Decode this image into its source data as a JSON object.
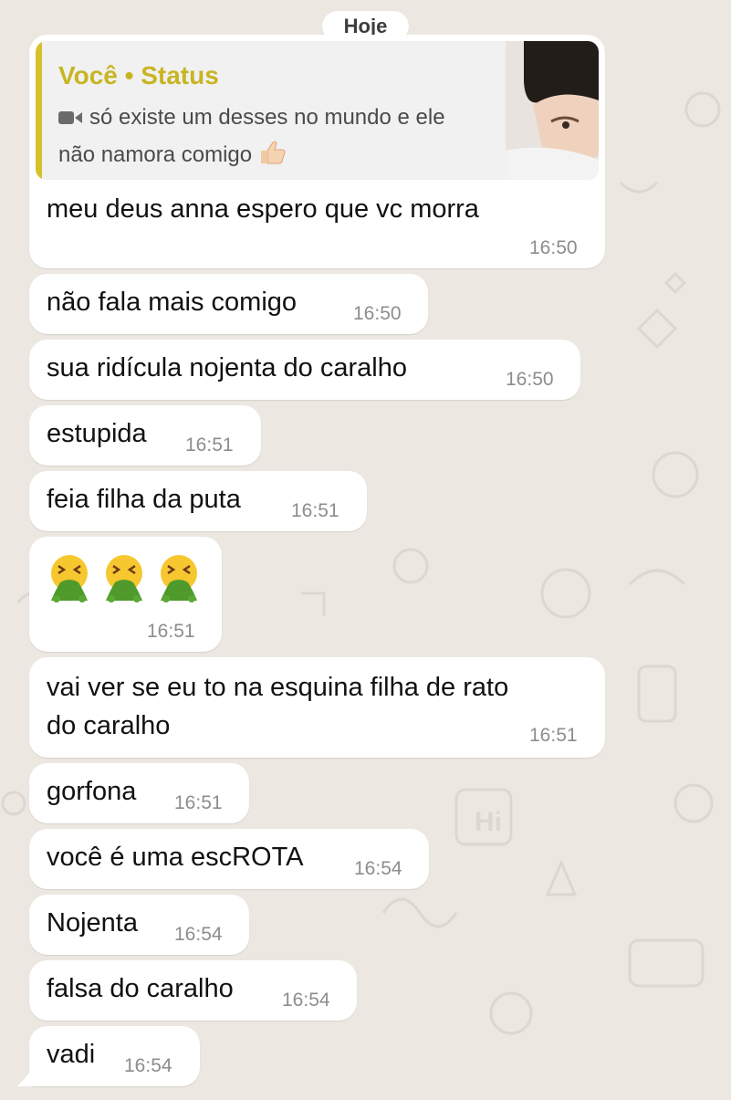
{
  "date_label": "Hoje",
  "quoted_status": {
    "author": "Você • Status",
    "line1": "só existe um desses no mundo e ele",
    "line2": "não namora comigo",
    "media_icon": "video-camera-icon",
    "emoji_icon": "thumbs-up-icon"
  },
  "messages": [
    {
      "text": "meu deus anna espero que vc morra",
      "time": "16:50"
    },
    {
      "text": "não fala mais comigo",
      "time": "16:50"
    },
    {
      "text": "sua ridícula nojenta do caralho",
      "time": "16:50"
    },
    {
      "text": "estupida",
      "time": "16:51"
    },
    {
      "text": "feia filha da puta",
      "time": "16:51"
    },
    {
      "emoji": [
        "vomiting-face-icon",
        "vomiting-face-icon",
        "vomiting-face-icon"
      ],
      "time": "16:51"
    },
    {
      "line1": "vai ver se eu to na esquina filha de rato",
      "line2": "do caralho",
      "time": "16:51"
    },
    {
      "text": "gorfona",
      "time": "16:51"
    },
    {
      "text": "você é uma escROTA",
      "time": "16:54"
    },
    {
      "text": "Nojenta",
      "time": "16:54"
    },
    {
      "text": "falsa do caralho",
      "time": "16:54"
    },
    {
      "text": "vadi",
      "time": "16:54"
    }
  ],
  "colors": {
    "wallpaper": "#ece8e1",
    "bubble": "#ffffff",
    "quote_accent": "#d6c12a",
    "quote_author": "#c8b523",
    "timestamp": "#8d8d8d"
  }
}
